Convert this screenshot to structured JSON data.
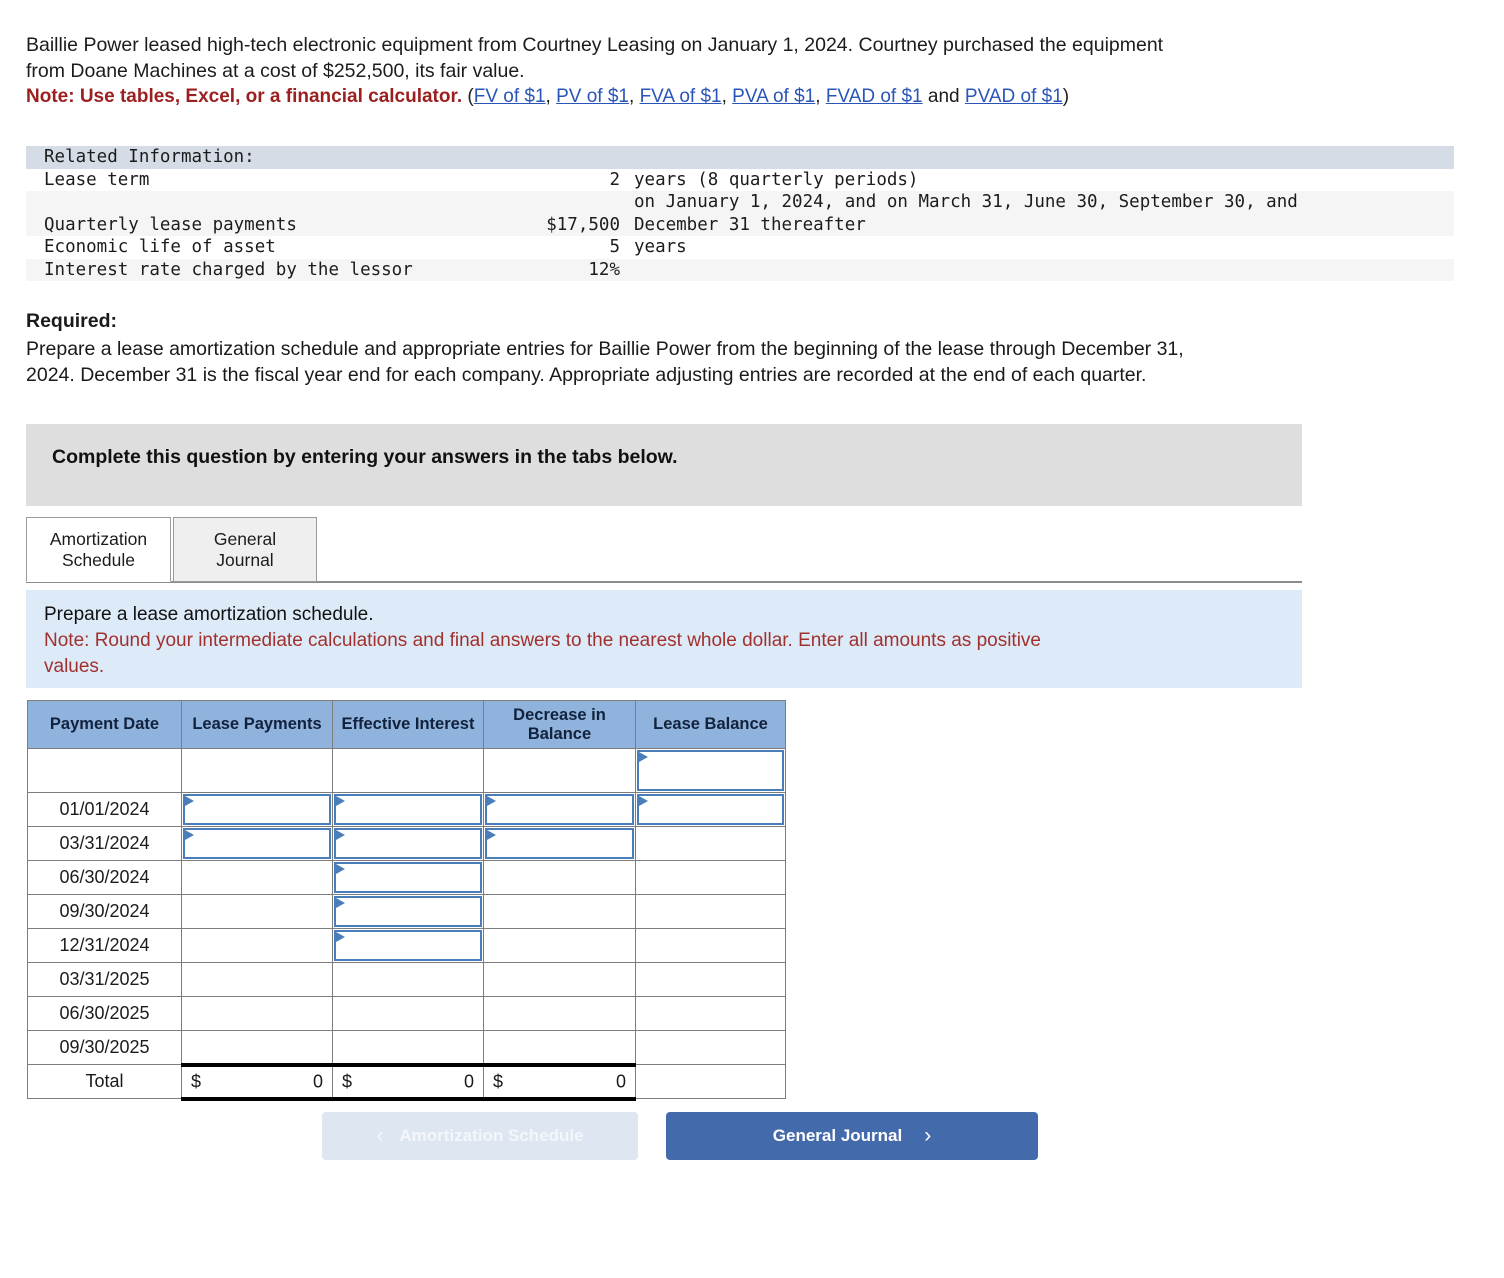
{
  "intro": {
    "line1": "Baillie Power leased high-tech electronic equipment from Courtney Leasing on January 1, 2024. Courtney purchased the equipment",
    "line2": "from Doane Machines at a cost of $252,500, its fair value.",
    "note_label": "Note: Use tables, Excel, or a financial calculator.",
    "open_paren": "(",
    "and_text": " and ",
    "close_paren": ")",
    "links": [
      {
        "label": "FV of $1"
      },
      {
        "label": "PV of $1"
      },
      {
        "label": "FVA of $1"
      },
      {
        "label": "PVA of $1"
      },
      {
        "label": "FVAD of $1"
      },
      {
        "label": "PVAD of $1"
      }
    ],
    "link_sep": ", "
  },
  "related_information": {
    "header": "Related Information:",
    "rows": [
      {
        "label": "Lease term",
        "value": "2",
        "rest": "years (8 quarterly periods)"
      },
      {
        "label": "",
        "value": "",
        "rest": "on January 1, 2024, and on March 31, June 30, September 30, and"
      },
      {
        "label": "Quarterly lease payments",
        "value": "$17,500",
        "rest": "December 31 thereafter"
      },
      {
        "label": "Economic life of asset",
        "value": "5",
        "rest": "years"
      },
      {
        "label": "Interest rate charged by the lessor",
        "value": "12%",
        "rest": ""
      }
    ]
  },
  "required": {
    "title": "Required:",
    "body_line1": "Prepare a lease amortization schedule and appropriate entries for Baillie Power from the beginning of the lease through December 31,",
    "body_line2": "2024. December 31 is the fiscal year end for each company. Appropriate adjusting entries are recorded at the end of each quarter."
  },
  "complete_box": {
    "text": "Complete this question by entering your answers in the tabs below."
  },
  "tabs": [
    {
      "line1": "Amortization",
      "line2": "Schedule",
      "active": true
    },
    {
      "line1": "General",
      "line2": "Journal",
      "active": false
    }
  ],
  "instruction_panel": {
    "line1": "Prepare a lease amortization schedule.",
    "line2": "Note: Round your intermediate calculations and final answers to the nearest whole dollar. Enter all amounts as positive",
    "line3": "values."
  },
  "amortization_table": {
    "columns": [
      "Payment Date",
      "Lease Payments",
      "Effective Interest",
      "Decrease in Balance",
      "Lease Balance"
    ],
    "rows": [
      {
        "date": "",
        "payments": "",
        "interest": "",
        "decrease": "",
        "balance": "",
        "inputs": [
          "balance"
        ]
      },
      {
        "date": "01/01/2024",
        "payments": "",
        "interest": "",
        "decrease": "",
        "balance": "",
        "inputs": [
          "payments",
          "interest",
          "decrease",
          "balance"
        ]
      },
      {
        "date": "03/31/2024",
        "payments": "",
        "interest": "",
        "decrease": "",
        "balance": "",
        "inputs": [
          "payments",
          "interest",
          "decrease"
        ]
      },
      {
        "date": "06/30/2024",
        "payments": "",
        "interest": "",
        "decrease": "",
        "balance": "",
        "inputs": [
          "interest"
        ]
      },
      {
        "date": "09/30/2024",
        "payments": "",
        "interest": "",
        "decrease": "",
        "balance": "",
        "inputs": [
          "interest"
        ]
      },
      {
        "date": "12/31/2024",
        "payments": "",
        "interest": "",
        "decrease": "",
        "balance": "",
        "inputs": [
          "interest"
        ]
      },
      {
        "date": "03/31/2025",
        "payments": "",
        "interest": "",
        "decrease": "",
        "balance": "",
        "inputs": []
      },
      {
        "date": "06/30/2025",
        "payments": "",
        "interest": "",
        "decrease": "",
        "balance": "",
        "inputs": []
      },
      {
        "date": "09/30/2025",
        "payments": "",
        "interest": "",
        "decrease": "",
        "balance": "",
        "inputs": []
      }
    ],
    "total_row": {
      "label": "Total",
      "currency": "$",
      "payments": "0",
      "interest": "0",
      "decrease": "0"
    }
  },
  "nav": {
    "prev_label": "Amortization Schedule",
    "prev_chevron": "‹",
    "next_label": "General Journal",
    "next_chevron": "›"
  },
  "colors": {
    "link": "#2a55b8",
    "note_red": "#9c1f1f",
    "instruction_red": "#a1312f",
    "table_header_blue": "#8fb3dc",
    "input_border_blue": "#4a7ebb",
    "panel_blue": "#ddeaf7",
    "gray_box": "#dedede",
    "primary_button": "#436bab",
    "disabled_button": "#dde6f1"
  }
}
